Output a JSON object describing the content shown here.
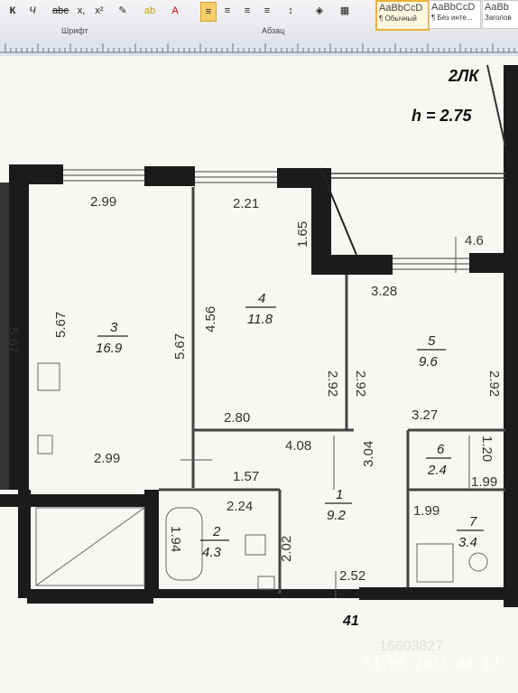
{
  "ribbon": {
    "font_group_label": "Шрифт",
    "para_group_label": "Абзац",
    "buttons": [
      "К",
      "Ч",
      "abe",
      "x,",
      "x²",
      "A"
    ],
    "styles": [
      {
        "preview": "AaBbCcD",
        "name": "¶ Обычный"
      },
      {
        "preview": "AaBbCcD",
        "name": "¶ Без инте..."
      },
      {
        "preview": "AaBb",
        "name": "Заголов"
      }
    ]
  },
  "plan": {
    "title": "2ЛК",
    "height": "h = 2.75",
    "floor_mark": "41",
    "rooms": [
      {
        "num": "1",
        "area": "9.2"
      },
      {
        "num": "2",
        "area": "4.3"
      },
      {
        "num": "3",
        "area": "16.9"
      },
      {
        "num": "4",
        "area": "11.8"
      },
      {
        "num": "5",
        "area": "9.6"
      },
      {
        "num": "6",
        "area": "2.4"
      },
      {
        "num": "7",
        "area": "3.4"
      }
    ],
    "balcony_area": "4.6",
    "dims": {
      "d299a": "2.99",
      "d221": "2.21",
      "d165": "1.65",
      "d567a": "5.67",
      "d567b": "5.67",
      "d456": "4.56",
      "d292a": "2.92",
      "d292b": "2.92",
      "d292c": "2.92",
      "d328": "3.28",
      "d280": "2.80",
      "d408": "4.08",
      "d327": "3.27",
      "d120": "1.20",
      "d299b": "2.99",
      "d157": "1.57",
      "d224": "2.24",
      "d304": "3.04",
      "d199a": "1.99",
      "d199b": "1.99",
      "d194": "1.94",
      "d202": "2.02",
      "d252": "2.52",
      "d567c": "5.67"
    }
  },
  "watermark": "16603827",
  "timestamp": "01.09.2023  08:12"
}
